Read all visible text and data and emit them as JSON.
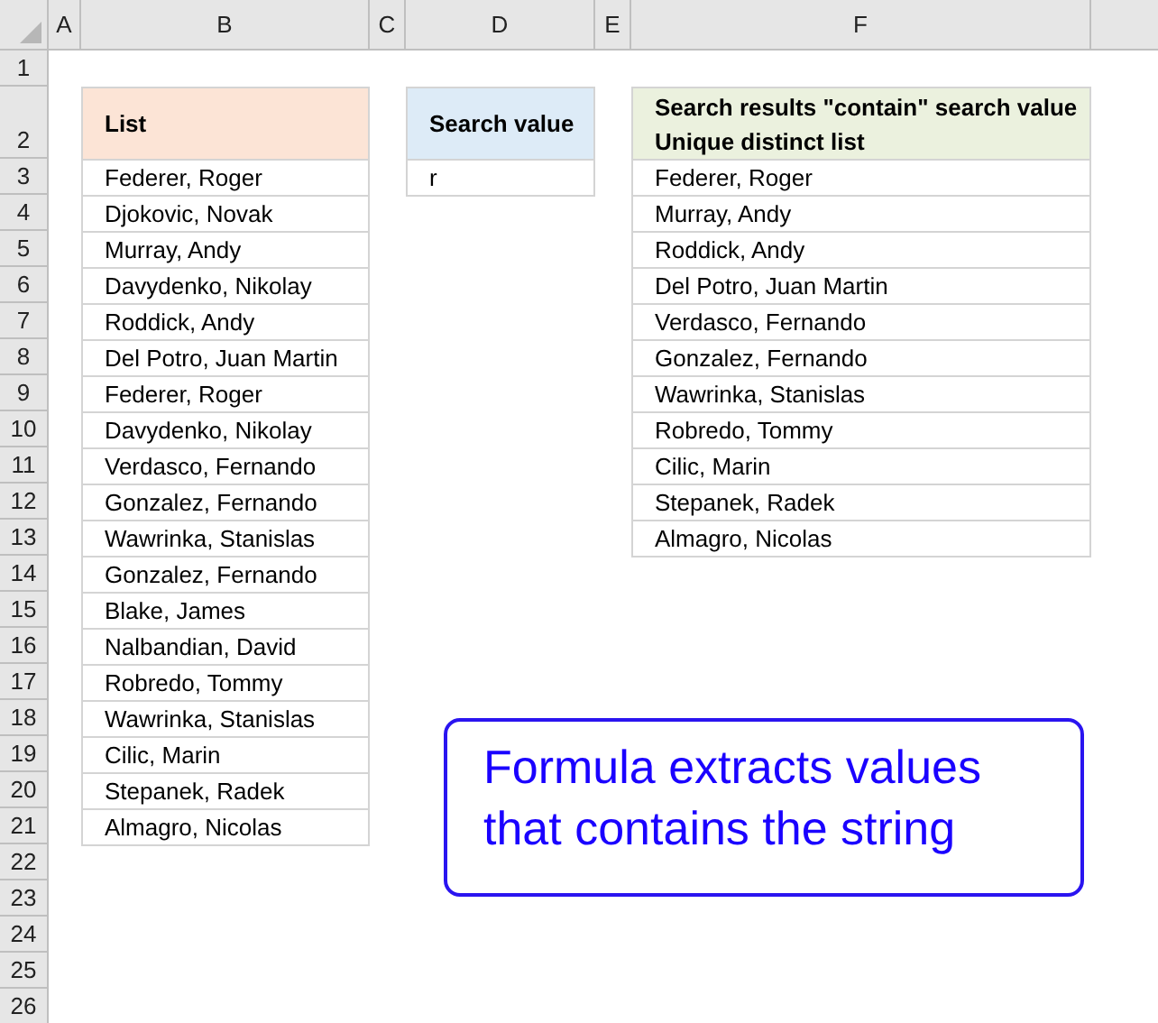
{
  "columns": [
    "A",
    "B",
    "C",
    "D",
    "E",
    "F"
  ],
  "rows": [
    "1",
    "2",
    "3",
    "4",
    "5",
    "6",
    "7",
    "8",
    "9",
    "10",
    "11",
    "12",
    "13",
    "14",
    "15",
    "16",
    "17",
    "18",
    "19",
    "20",
    "21",
    "22",
    "23",
    "24",
    "25",
    "26"
  ],
  "list": {
    "header": "List",
    "items": [
      "Federer, Roger",
      "Djokovic, Novak",
      "Murray, Andy",
      "Davydenko, Nikolay",
      "Roddick, Andy",
      "Del Potro, Juan Martin",
      "Federer, Roger",
      "Davydenko, Nikolay",
      "Verdasco, Fernando",
      "Gonzalez, Fernando",
      "Wawrinka, Stanislas",
      "Gonzalez, Fernando",
      "Blake, James",
      "Nalbandian, David",
      "Robredo, Tommy",
      "Wawrinka, Stanislas",
      "Cilic, Marin",
      "Stepanek, Radek",
      "Almagro, Nicolas"
    ]
  },
  "search": {
    "header": "Search value",
    "value": "r"
  },
  "results": {
    "header_lines": [
      "Search results \"contain\" search value",
      "Unique distinct list"
    ],
    "items": [
      "Federer, Roger",
      "Murray, Andy",
      "Roddick, Andy",
      "Del Potro, Juan Martin",
      "Verdasco, Fernando",
      "Gonzalez, Fernando",
      "Wawrinka, Stanislas",
      "Robredo, Tommy",
      "Cilic, Marin",
      "Stepanek, Radek",
      "Almagro, Nicolas"
    ]
  },
  "callout": {
    "lines": [
      "Formula extracts values",
      "that contains the string"
    ]
  }
}
